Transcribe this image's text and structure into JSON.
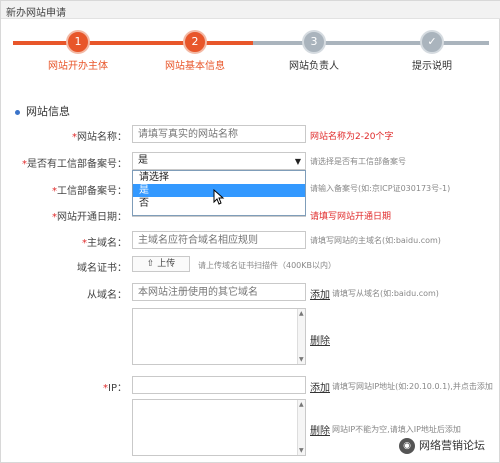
{
  "window": {
    "title": "新办网站申请"
  },
  "colors": {
    "accent": "#e8562a",
    "inactive": "#aab4bd",
    "error": "#e02a2a",
    "selected_option": "#3399ff"
  },
  "stepper": {
    "steps": [
      {
        "num": "1",
        "label": "网站开办主体",
        "state": "done"
      },
      {
        "num": "2",
        "label": "网站基本信息",
        "state": "current"
      },
      {
        "num": "3",
        "label": "网站负责人",
        "state": "pending"
      },
      {
        "num": "✓",
        "label": "提示说明",
        "state": "pending"
      }
    ]
  },
  "section": {
    "title": "网站信息"
  },
  "form": {
    "site_name": {
      "label": "网站名称：",
      "placeholder": "请填写真实的网站名称",
      "error": "网站名称为2-20个字"
    },
    "icp_filed": {
      "label": "是否有工信部备案号：",
      "value": "是",
      "hint": "请选择是否有工信部备案号",
      "options": [
        "请选择",
        "是",
        "否"
      ]
    },
    "icp_number": {
      "label": "工信部备案号：",
      "hint": "请输入备案号(如:京ICP证030173号-1)"
    },
    "open_date": {
      "label": "网站开通日期：",
      "error": "请填写网站开通日期"
    },
    "main_domain": {
      "label": "主域名：",
      "placeholder": "主域名应符合域名相应规则",
      "hint": "请填写网站的主域名(如:baidu.com)"
    },
    "domain_cert": {
      "label": "域名证书：",
      "button": "上传",
      "hint": "请上传域名证书扫描件（400KB以内）"
    },
    "sub_domain": {
      "label": "从域名：",
      "placeholder": "本网站注册使用的其它域名",
      "add": "添加",
      "hint": "请填写从域名(如:baidu.com)",
      "delete": "删除"
    },
    "ip": {
      "label": "IP：",
      "add": "添加",
      "hint": "请填写网站IP地址(如:20.10.0.1),并点击添加",
      "delete": "删除",
      "note": "网站IP不能为空,请填入IP地址后添加"
    }
  },
  "watermark": {
    "text": "网络营销论坛"
  }
}
